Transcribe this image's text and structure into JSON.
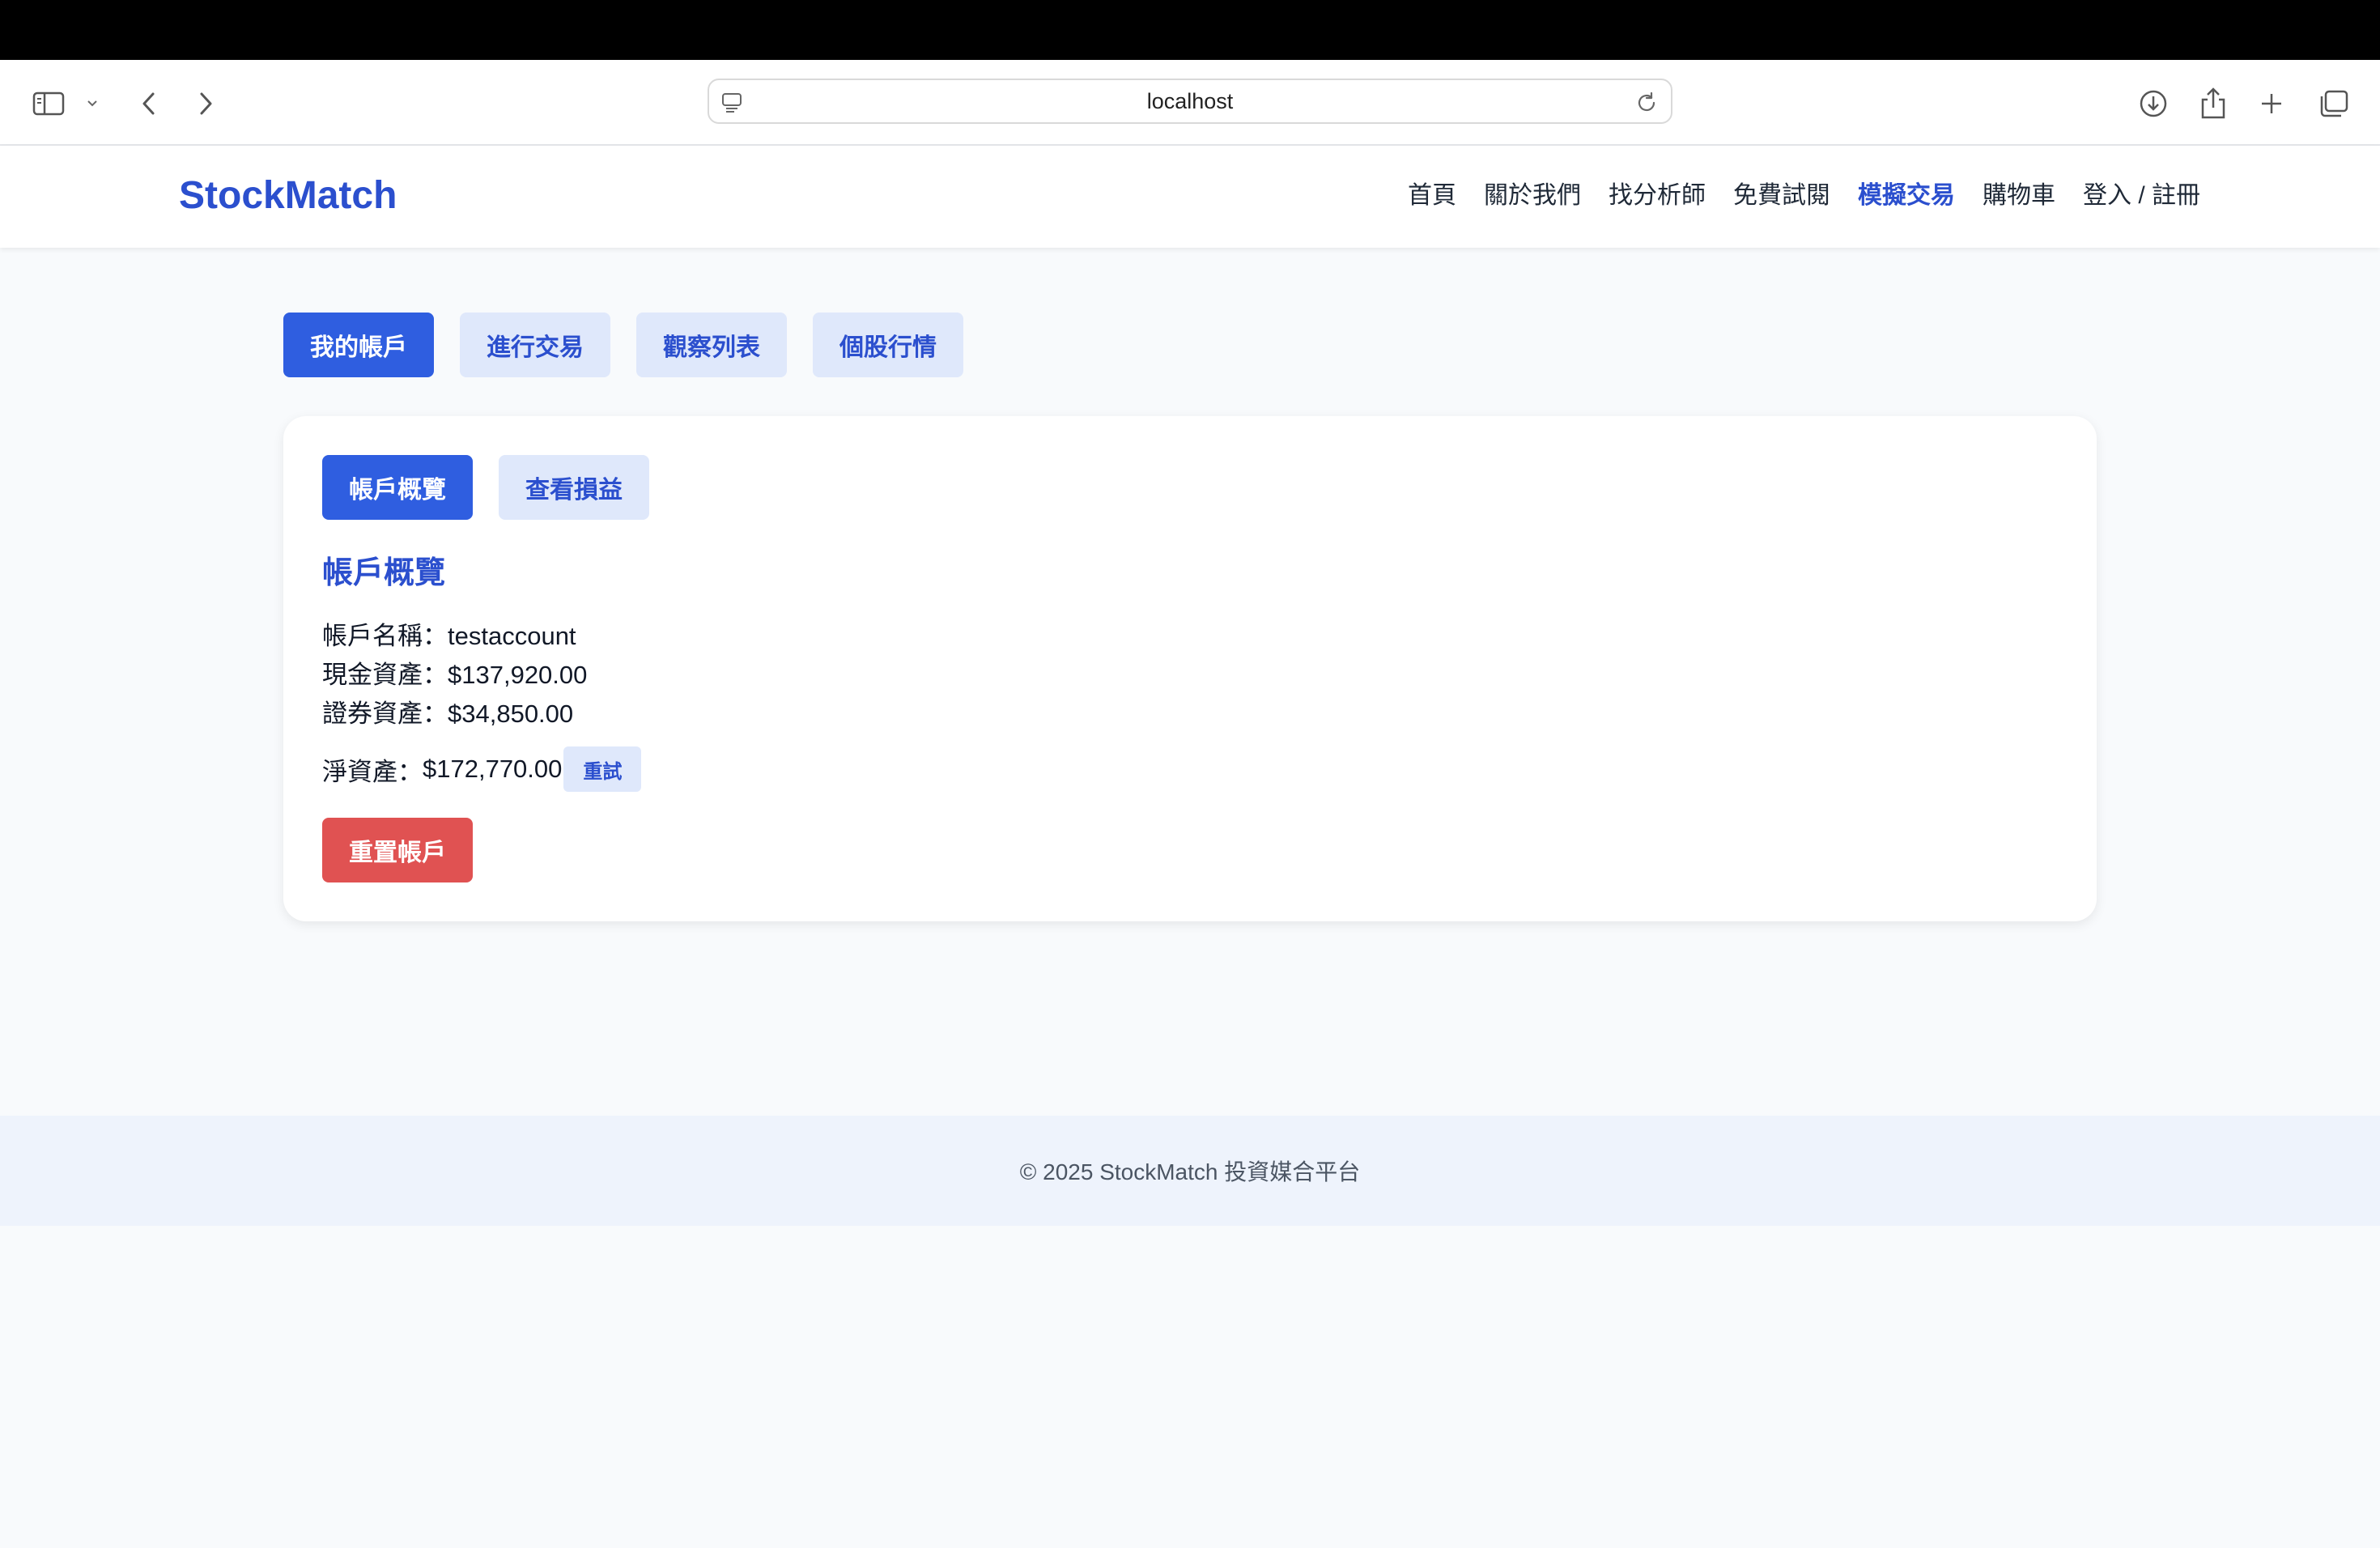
{
  "browser": {
    "url": "localhost"
  },
  "site": {
    "logo": "StockMatch",
    "nav": [
      {
        "label": "首頁",
        "active": false
      },
      {
        "label": "關於我們",
        "active": false
      },
      {
        "label": "找分析師",
        "active": false
      },
      {
        "label": "免費試閱",
        "active": false
      },
      {
        "label": "模擬交易",
        "active": true
      },
      {
        "label": "購物車",
        "active": false
      },
      {
        "label": "登入 / 註冊",
        "active": false
      }
    ]
  },
  "main_tabs": [
    {
      "label": "我的帳戶",
      "active": true
    },
    {
      "label": "進行交易",
      "active": false
    },
    {
      "label": "觀察列表",
      "active": false
    },
    {
      "label": "個股行情",
      "active": false
    }
  ],
  "account": {
    "sub_tabs": [
      {
        "label": "帳戶概覽",
        "active": true
      },
      {
        "label": "查看損益",
        "active": false
      }
    ],
    "section_title": "帳戶概覽",
    "name_label": "帳戶名稱：",
    "name_value": "testaccount",
    "cash_label": "現金資產：",
    "cash_value": "$137,920.00",
    "securities_label": "證券資產：",
    "securities_value": "$34,850.00",
    "net_label": "淨資產：",
    "net_value": "$172,770.00",
    "retry_label": "重試",
    "reset_label": "重置帳戶"
  },
  "footer": {
    "text": "© 2025 StockMatch 投資媒合平台"
  },
  "colors": {
    "brand": "#2b4fce",
    "tab_active": "#2f5ee0",
    "tab_inactive_bg": "#dfe8fb",
    "danger": "#e05252",
    "page_bg": "#f8fafc",
    "footer_bg": "#eef3fc"
  }
}
